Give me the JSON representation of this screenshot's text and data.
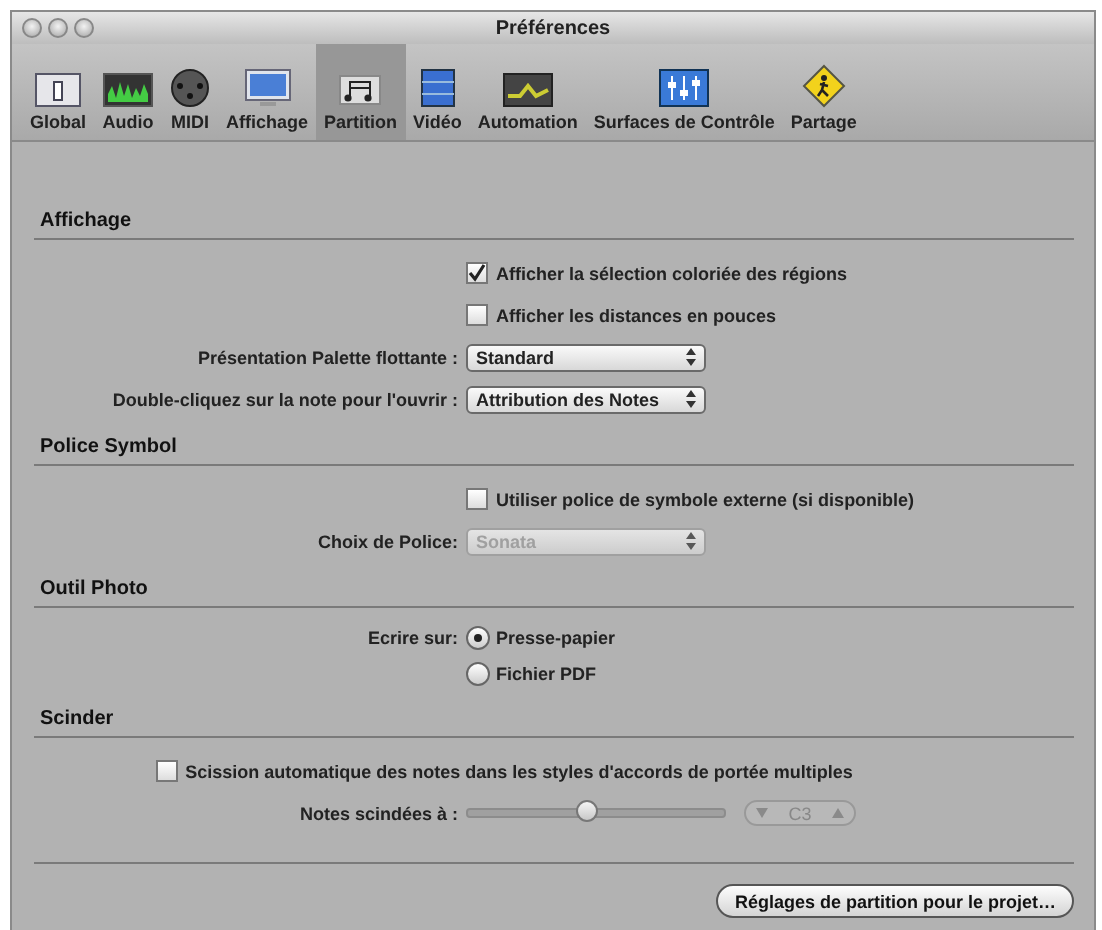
{
  "window": {
    "title": "Préférences"
  },
  "tabs": [
    {
      "label": "Global",
      "selected": false
    },
    {
      "label": "Audio",
      "selected": false
    },
    {
      "label": "MIDI",
      "selected": false
    },
    {
      "label": "Affichage",
      "selected": false
    },
    {
      "label": "Partition",
      "selected": true
    },
    {
      "label": "Vidéo",
      "selected": false
    },
    {
      "label": "Automation",
      "selected": false
    },
    {
      "label": "Surfaces de Contrôle",
      "selected": false
    },
    {
      "label": "Partage",
      "selected": false
    }
  ],
  "sections": [
    {
      "title": "Affichage",
      "rows": [
        {
          "kind": "checkbox",
          "text": "Afficher la sélection coloriée des régions",
          "checked": true,
          "disabled": false
        },
        {
          "kind": "checkbox",
          "text": "Afficher les distances en pouces",
          "checked": false,
          "disabled": false
        },
        {
          "kind": "popup",
          "label": "Présentation Palette flottante :",
          "value": "Standard",
          "disabled": false
        },
        {
          "kind": "popup",
          "label": "Double-cliquez sur la note pour l'ouvrir :",
          "value": "Attribution des Notes",
          "disabled": false
        }
      ]
    },
    {
      "title": "Police Symbol",
      "rows": [
        {
          "kind": "checkbox",
          "text": "Utiliser police de symbole externe (si disponible)",
          "checked": false,
          "disabled": false
        },
        {
          "kind": "popup",
          "label": "Choix de Police:",
          "value": "Sonata",
          "disabled": true
        }
      ]
    },
    {
      "title": "Outil Photo",
      "rows": [
        {
          "kind": "radio",
          "label": "Ecrire sur:",
          "text": "Presse-papier",
          "selected": true
        },
        {
          "kind": "radio",
          "text": "Fichier PDF",
          "selected": false
        }
      ]
    },
    {
      "title": "Scinder",
      "rows": [
        {
          "kind": "widecheck",
          "text": "Scission automatique des notes dans les styles d'accords de portée multiples",
          "checked": false,
          "disabled": false
        },
        {
          "kind": "slider",
          "label": "Notes scindées à :",
          "level": 0.47,
          "value": "C3",
          "disabled": true
        }
      ]
    }
  ],
  "footer_button": "Réglages de partition pour le projet…"
}
